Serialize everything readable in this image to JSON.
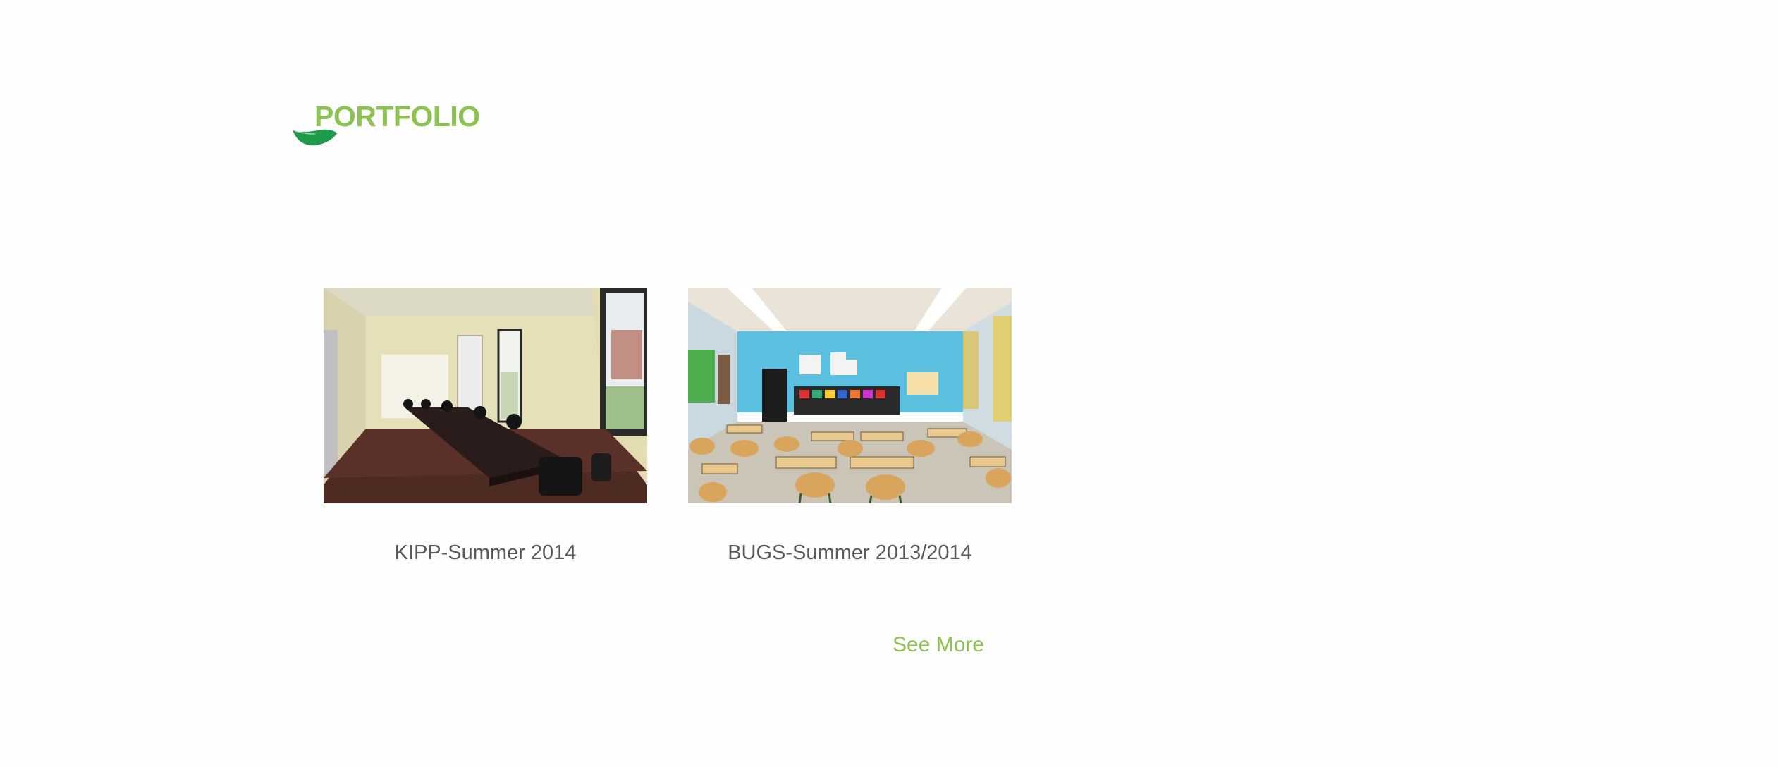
{
  "section": {
    "title": "PORTFOLIO",
    "accent_color": "#8cc251",
    "leaf_color": "#1f9a4a",
    "leaf_icon": "leaf-icon"
  },
  "portfolio": {
    "items": [
      {
        "caption": "KIPP-Summer 2014",
        "image": "empty-conference-room-with-long-table-photo"
      },
      {
        "caption": "BUGS-Summer 2013/2014",
        "image": "classroom-with-desks-and-blue-wall-photo"
      }
    ],
    "see_more_label": "See More"
  }
}
